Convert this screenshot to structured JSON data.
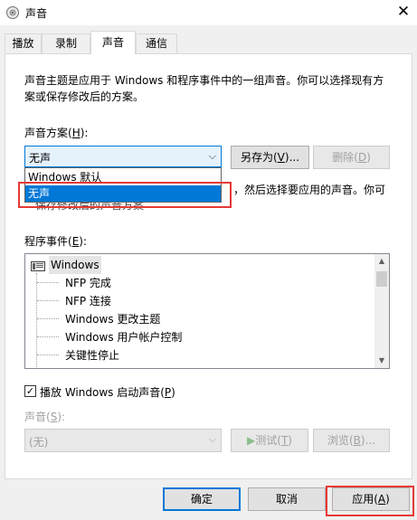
{
  "window": {
    "title": "声音",
    "close_glyph": "✕"
  },
  "tabs": [
    {
      "label": "播放",
      "active": false
    },
    {
      "label": "录制",
      "active": false
    },
    {
      "label": "声音",
      "active": true
    },
    {
      "label": "通信",
      "active": false
    }
  ],
  "description_line1": "声音主题是应用于 Windows 和程序事件中的一组声音。你可以选择现有方",
  "description_line2": "案或保存修改后的方案。",
  "scheme": {
    "label_pre": "声音方案(",
    "label_key": "H",
    "label_post": "):",
    "selected": "无声",
    "arrow": "⌵",
    "options": [
      {
        "label": "Windows 默认",
        "selected": false
      },
      {
        "label": "无声",
        "selected": true
      }
    ],
    "save_as_label_pre": "另存为(",
    "save_as_label_key": "V",
    "save_as_label_post": ")...",
    "delete_label_pre": "删除(",
    "delete_label_key": "D",
    "delete_label_post": ")"
  },
  "hint_visible": "，然后选择要应用的声音。你可",
  "hint_obscured": "保存修改后的声音方案",
  "events": {
    "label_pre": "程序事件(",
    "label_key": "E",
    "label_post": "):",
    "root": "Windows",
    "items": [
      "NFP 完成",
      "NFP 连接",
      "Windows 更改主题",
      "Windows 用户帐户控制",
      "关键性停止"
    ],
    "scroll_up": "▲",
    "scroll_down": "▼"
  },
  "startup": {
    "checked": true,
    "check_glyph": "✓",
    "label_pre": "播放 Windows 启动声音(",
    "label_key": "P",
    "label_post": ")"
  },
  "sound": {
    "label_pre": "声音(",
    "label_key": "S",
    "label_post": "):",
    "value": "(无)",
    "arrow": "⌵",
    "test_icon": "▶",
    "test_label_pre": "测试(",
    "test_label_key": "T",
    "test_label_post": ")",
    "browse_label_pre": "浏览(",
    "browse_label_key": "B",
    "browse_label_post": ")..."
  },
  "footer": {
    "ok": "确定",
    "cancel": "取消",
    "apply_pre": "应用(",
    "apply_key": "A",
    "apply_post": ")"
  },
  "colors": {
    "accent": "#0078d7",
    "highlight_box": "#e53935",
    "disabled_text": "#a0a0a0"
  }
}
